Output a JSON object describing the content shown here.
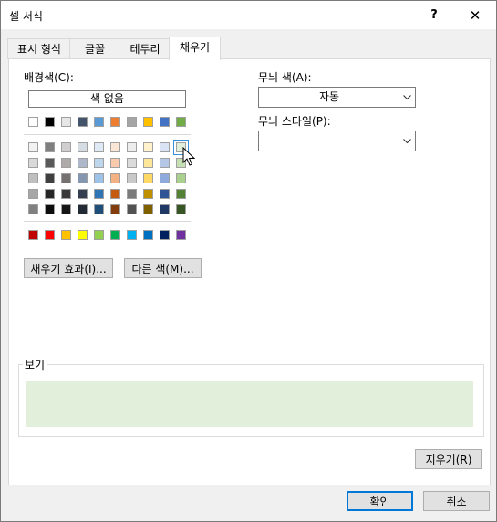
{
  "title": "셀 서식",
  "title_buttons": {
    "help": "?",
    "close": "✕"
  },
  "tabs": [
    "표시 형식",
    "글꼴",
    "테두리",
    "채우기"
  ],
  "active_tab": 3,
  "background_color": {
    "label": "배경색(C):",
    "no_color": "색 없음"
  },
  "palette": {
    "selected": "#e2efda",
    "row_standard_top": [
      "#ffffff",
      "#000000",
      "#e7e6e6",
      "#44546a",
      "#5b9bd5",
      "#ed7d31",
      "#a5a5a5",
      "#ffc000",
      "#4472c4",
      "#70ad47"
    ],
    "tints": [
      [
        "#f2f2f2",
        "#7f7f7f",
        "#d0cece",
        "#d6dce4",
        "#deebf6",
        "#fbe5d5",
        "#ededed",
        "#fff2cc",
        "#dae3f3",
        "#e2efda"
      ],
      [
        "#d9d9d9",
        "#595959",
        "#aeaaaa",
        "#adb9ca",
        "#bdd7ee",
        "#f8cbad",
        "#dbdbdb",
        "#ffe699",
        "#b4c7e7",
        "#c6e0b4"
      ],
      [
        "#bfbfbf",
        "#3f3f3f",
        "#757171",
        "#8496b0",
        "#9dc3e6",
        "#f4b183",
        "#c9c9c9",
        "#ffd966",
        "#8faadc",
        "#a9d08e"
      ],
      [
        "#a6a6a6",
        "#262626",
        "#3a3838",
        "#333f4f",
        "#2f75b5",
        "#c55a11",
        "#7b7b7b",
        "#bf8f00",
        "#2f5597",
        "#548235"
      ],
      [
        "#808080",
        "#0d0d0d",
        "#171616",
        "#222b35",
        "#1f4e79",
        "#833c0b",
        "#525252",
        "#7f6000",
        "#1f3864",
        "#375623"
      ]
    ],
    "standard": [
      "#c00000",
      "#ff0000",
      "#ffc000",
      "#ffff00",
      "#92d050",
      "#00b050",
      "#00b0f0",
      "#0070c0",
      "#002060",
      "#7030a0"
    ]
  },
  "buttons": {
    "fill_effects": "채우기 효과(I)...",
    "more_colors": "다른 색(M)...",
    "clear": "지우기(R)",
    "ok": "확인",
    "cancel": "취소"
  },
  "pattern": {
    "color_label": "무늬 색(A):",
    "color_value": "자동",
    "style_label": "무늬 스타일(P):",
    "style_value": ""
  },
  "preview": {
    "label": "보기",
    "color": "#e2efda"
  }
}
